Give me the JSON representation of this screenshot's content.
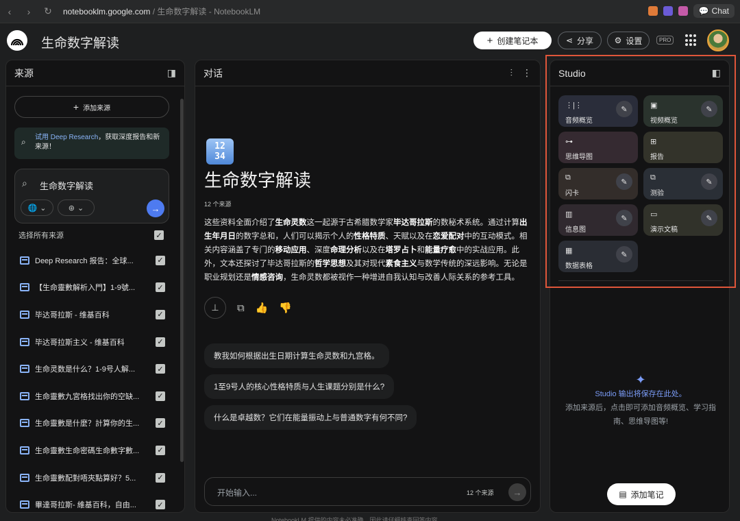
{
  "browser": {
    "url_host": "notebooklm.google.com",
    "url_rest": " / 生命数字解读 - NotebookLM",
    "chat_label": "Chat"
  },
  "header": {
    "title": "生命数字解读",
    "create_label": "创建笔记本",
    "share_label": "分享",
    "settings_label": "设置",
    "pro_label": "PRO"
  },
  "sources": {
    "title": "来源",
    "add_label": "添加来源",
    "research_link": "试用 Deep Research",
    "research_text": "，获取深度报告和新来源！",
    "search_value": "生命数字解读",
    "select_all": "选择所有来源",
    "items": [
      {
        "label": "Deep Research 报告：全球..."
      },
      {
        "label": "【生命靈數解析入門】1-9號..."
      },
      {
        "label": "毕达哥拉斯 - 维基百科"
      },
      {
        "label": "毕达哥拉斯主义 - 维基百科"
      },
      {
        "label": "生命灵数是什么？1-9号人解..."
      },
      {
        "label": "生命靈數九宮格找出你的空缺..."
      },
      {
        "label": "生命靈數是什麼？計算你的生..."
      },
      {
        "label": "生命靈數生命密碼生命數字數..."
      },
      {
        "label": "生命靈數配對唔夾點算好？5..."
      },
      {
        "label": "畢達哥拉斯- 維基百科，自由..."
      }
    ]
  },
  "chat": {
    "title": "对话",
    "emoji_text": "1234",
    "notebook_title": "生命数字解读",
    "source_count": "12 个来源",
    "summary_parts": [
      {
        "t": "这些资料全面介绍了",
        "b": false
      },
      {
        "t": "生命灵数",
        "b": true
      },
      {
        "t": "这一起源于古希腊数学家",
        "b": false
      },
      {
        "t": "毕达哥拉斯",
        "b": true
      },
      {
        "t": "的数秘术系统。通过计算",
        "b": false
      },
      {
        "t": "出生年月日",
        "b": true
      },
      {
        "t": "的数字总和，人们可以揭示个人的",
        "b": false
      },
      {
        "t": "性格特质",
        "b": true
      },
      {
        "t": "、天赋以及在",
        "b": false
      },
      {
        "t": "恋爱配对",
        "b": true
      },
      {
        "t": "中的互动模式。相关内容涵盖了专门的",
        "b": false
      },
      {
        "t": "移动应用",
        "b": true
      },
      {
        "t": "、深度",
        "b": false
      },
      {
        "t": "命理分析",
        "b": true
      },
      {
        "t": "以及在",
        "b": false
      },
      {
        "t": "塔罗占卜",
        "b": true
      },
      {
        "t": "和",
        "b": false
      },
      {
        "t": "能量疗愈",
        "b": true
      },
      {
        "t": "中的实战应用。此外，文本还探讨了毕达哥拉斯的",
        "b": false
      },
      {
        "t": "哲学思想",
        "b": true
      },
      {
        "t": "及其对现代",
        "b": false
      },
      {
        "t": "素食主义",
        "b": true
      },
      {
        "t": "与数学传统的深远影响。无论是职业规划还是",
        "b": false
      },
      {
        "t": "情感咨询",
        "b": true
      },
      {
        "t": "，生命灵数都被视作一种增进自我认知与改善人际关系的参考工具。",
        "b": false
      }
    ],
    "questions": [
      "教我如何根据出生日期计算生命灵数和九宫格。",
      "1至9号人的核心性格特质与人生课题分别是什么?",
      "什么是卓越数？它们在能量振动上与普通数字有何不同?"
    ],
    "input_placeholder": "开始输入...",
    "input_count": "12 个来源"
  },
  "studio": {
    "title": "Studio",
    "tiles": [
      {
        "label": "音频概览",
        "icon": "waveform-icon",
        "glyph": "⋮|⋮",
        "bg": "#2a2d3a",
        "edit": true
      },
      {
        "label": "视频概览",
        "icon": "video-icon",
        "glyph": "▣",
        "bg": "#2a332d",
        "edit": true
      },
      {
        "label": "思维导图",
        "icon": "mindmap-icon",
        "glyph": "⊶",
        "bg": "#352a31",
        "edit": false
      },
      {
        "label": "报告",
        "icon": "report-icon",
        "glyph": "⊞",
        "bg": "#33332a",
        "edit": false
      },
      {
        "label": "闪卡",
        "icon": "flashcard-icon",
        "glyph": "⧉",
        "bg": "#332d2a",
        "edit": true
      },
      {
        "label": "测验",
        "icon": "quiz-icon",
        "glyph": "⧉",
        "bg": "#2a2f36",
        "edit": true
      },
      {
        "label": "信息图",
        "icon": "infographic-icon",
        "glyph": "▥",
        "bg": "#30292f",
        "edit": true
      },
      {
        "label": "演示文稿",
        "icon": "slides-icon",
        "glyph": "▭",
        "bg": "#31322a",
        "edit": true
      },
      {
        "label": "数据表格",
        "icon": "table-icon",
        "glyph": "▦",
        "bg": "#2a2d34",
        "edit": true
      }
    ],
    "empty_title": "Studio 输出将保存在此处。",
    "empty_desc": "添加来源后，点击即可添加音频概览、学习指南、思维导图等!",
    "add_note_label": "添加笔记"
  },
  "footer": "NotebookLM 提供的内容未必准确，因此请仔细核查回答内容。"
}
